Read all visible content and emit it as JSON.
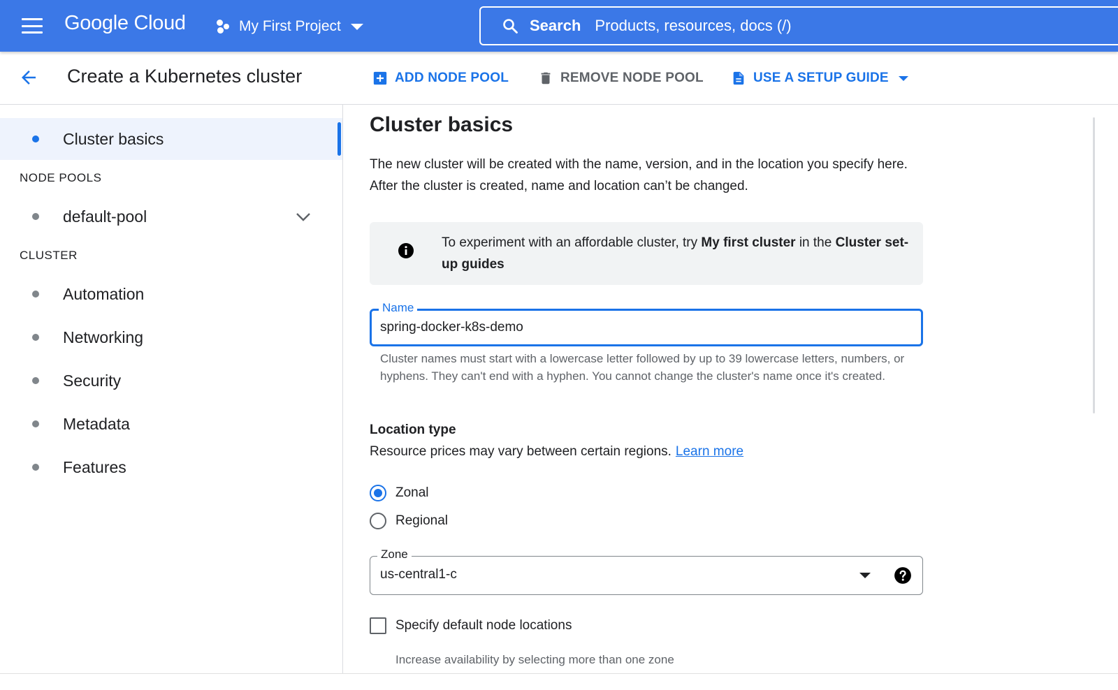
{
  "topbar": {
    "brand": "Google Cloud",
    "project_name": "My First Project",
    "search_label": "Search",
    "search_placeholder": "Products, resources, docs (/)"
  },
  "header": {
    "title": "Create a Kubernetes cluster",
    "actions": {
      "add_node_pool": "ADD NODE POOL",
      "remove_node_pool": "REMOVE NODE POOL",
      "use_setup_guide": "USE A SETUP GUIDE"
    }
  },
  "sidebar": {
    "active_item": "Cluster basics",
    "sections": [
      {
        "title": "NODE POOLS",
        "items": [
          "default-pool"
        ]
      },
      {
        "title": "CLUSTER",
        "items": [
          "Automation",
          "Networking",
          "Security",
          "Metadata",
          "Features"
        ]
      }
    ]
  },
  "main": {
    "title": "Cluster basics",
    "description": "The new cluster will be created with the name, version, and in the location you specify here. After the cluster is created, name and location can’t be changed.",
    "info": {
      "text_pre": "To experiment with an affordable cluster, try ",
      "bold1": "My first cluster",
      "text_mid": " in the ",
      "bold2": "Cluster set-up guides"
    },
    "name_field": {
      "label": "Name",
      "value": "spring-docker-k8s-demo",
      "hint": "Cluster names must start with a lowercase letter followed by up to 39 lowercase letters, numbers, or hyphens. They can't end with a hyphen. You cannot change the cluster's name once it's created."
    },
    "location_type": {
      "title": "Location type",
      "description": "Resource prices may vary between certain regions.",
      "learn_more": "Learn more",
      "options": [
        "Zonal",
        "Regional"
      ],
      "selected": "Zonal"
    },
    "zone_field": {
      "label": "Zone",
      "value": "us-central1-c"
    },
    "default_node_locations": {
      "label": "Specify default node locations",
      "checked": false,
      "hint": "Increase availability by selecting more than one zone"
    }
  },
  "colors": {
    "topbar": "#3b78e7",
    "accent": "#1a73e8",
    "active_item_bg": "#eef3fd",
    "info_bg": "#f1f3f4"
  },
  "icons": {
    "menu": "hamburger-icon",
    "project": "project-dots-icon",
    "search": "search-icon",
    "back": "arrow-back-icon",
    "add": "add-box-icon",
    "remove": "trash-icon",
    "guide": "document-icon",
    "info": "info-icon",
    "help": "help-icon",
    "expand": "chevron-down-icon"
  }
}
